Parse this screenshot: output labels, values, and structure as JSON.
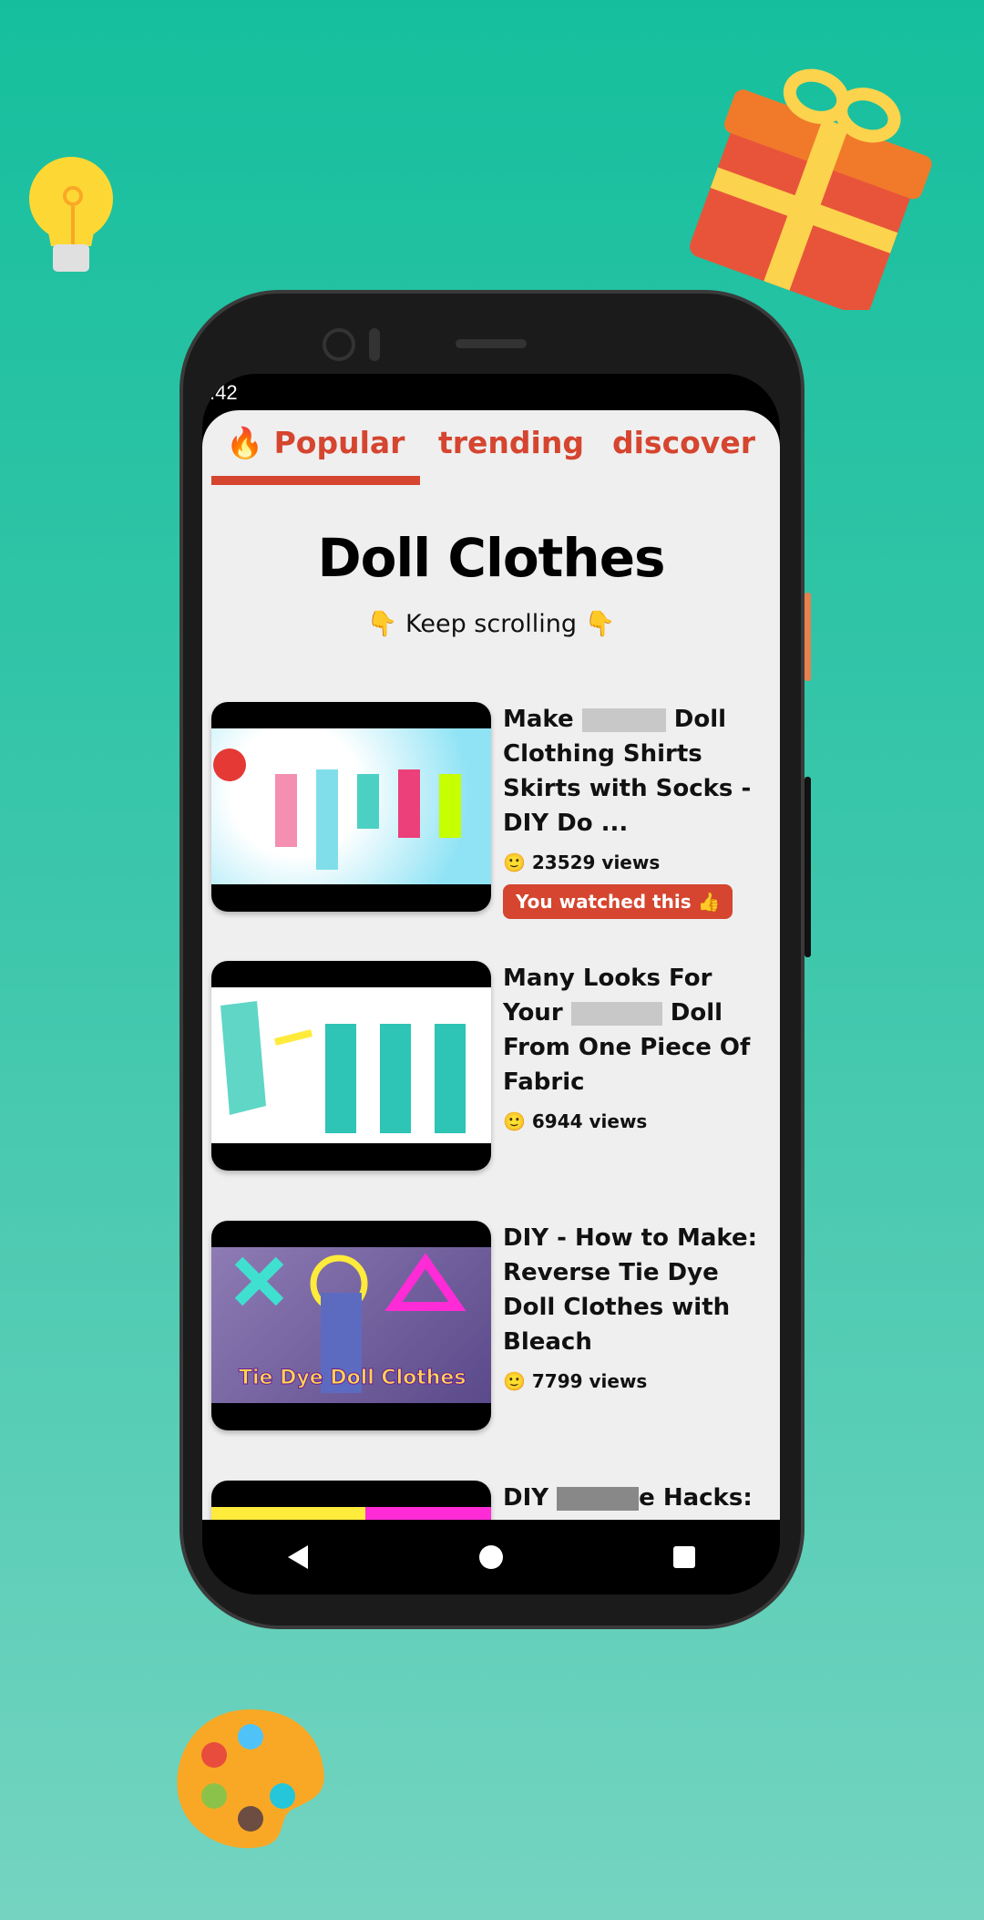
{
  "status_bar": {
    "time": ".42"
  },
  "tabs": [
    {
      "icon": "🔥",
      "label": "Popular",
      "active": true
    },
    {
      "label": "trending"
    },
    {
      "label": "discover"
    }
  ],
  "page": {
    "title": "Doll Clothes",
    "subtitle": "👇 Keep scrolling 👇"
  },
  "videos": [
    {
      "title_a": "Make",
      "title_b": "Doll Clothing Shirts Skirts with Socks - DIY Do ...",
      "views": "23529 views",
      "watched": "You watched this 👍"
    },
    {
      "title_a": "Many Looks For Your",
      "title_b": "Doll From One Piece Of Fabric",
      "views": "6944 views"
    },
    {
      "title": "DIY - How to Make: Reverse Tie Dye Doll Clothes with Bleach",
      "views": "7799 views",
      "thumb_text": "Tie Dye Doll Clothes"
    },
    {
      "title_a": "DIY",
      "title_b": "e Hacks:"
    }
  ],
  "views_icon": "🙂",
  "colors": {
    "accent": "#d5452f",
    "background_top": "#15bf9d",
    "background_bottom": "#74d4c1",
    "app_bg": "#efefef"
  }
}
